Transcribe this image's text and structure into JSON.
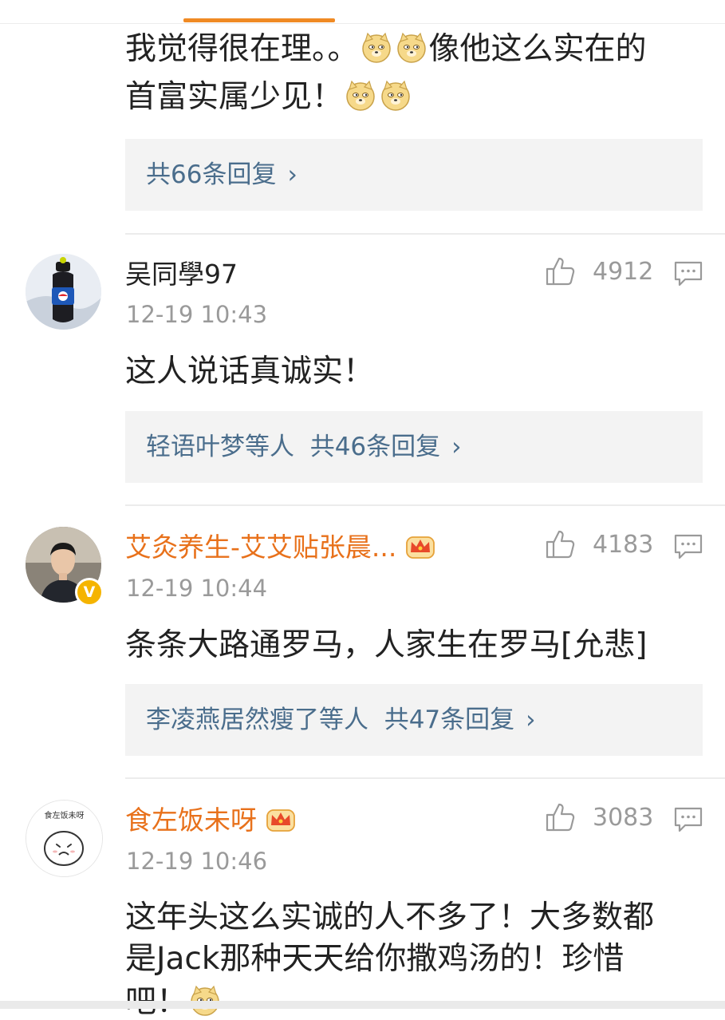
{
  "prev_comment": {
    "line1": "我觉得很在理。。",
    "line1_tail": "像他这么实在的",
    "line2": "首富实属少见！",
    "emoji_names": [
      "doge-emoji",
      "doge-emoji",
      "doge-emoji",
      "doge-emoji"
    ],
    "replies_summary": "共66条回复"
  },
  "comments": [
    {
      "username": "吴同學97",
      "username_style": "normal",
      "timestamp": "12-19 10:43",
      "likes": "4912",
      "text": "这人说话真诚实！",
      "replies_summary": "轻语叶梦等人  共46条回复",
      "avatar": "pepsi-bottle-avatar"
    },
    {
      "username": "艾灸养生-艾艾贴张晨...",
      "username_style": "vip",
      "verified_badge": "V",
      "timestamp": "12-19 10:44",
      "likes": "4183",
      "text": "条条大路通罗马，人家生在罗马[允悲]",
      "replies_summary": "李凌燕居然瘦了等人  共47条回复",
      "avatar": "man-portrait-avatar"
    },
    {
      "username": "食左饭未呀",
      "username_style": "vip",
      "timestamp": "12-19 10:46",
      "likes": "3083",
      "text_line1": "这年头这么实诚的人不多了！大多数都",
      "text_line2": "是Jack那种天天给你撒鸡汤的！珍惜",
      "text_line3": "吧！",
      "avatar": "cartoon-avatar",
      "avatar_caption": "食左饭未呀"
    }
  ],
  "icons": {
    "like": "thumbs-up-icon",
    "comment": "comment-bubble-icon",
    "arrow": "chevron-right-icon",
    "vip": "crown-badge-icon"
  },
  "colors": {
    "accent": "#f08a24",
    "vip_name": "#e8711b",
    "reply_link": "#4a6d8c",
    "meta_gray": "#9a9a9a",
    "reply_bg": "#f3f3f3"
  }
}
